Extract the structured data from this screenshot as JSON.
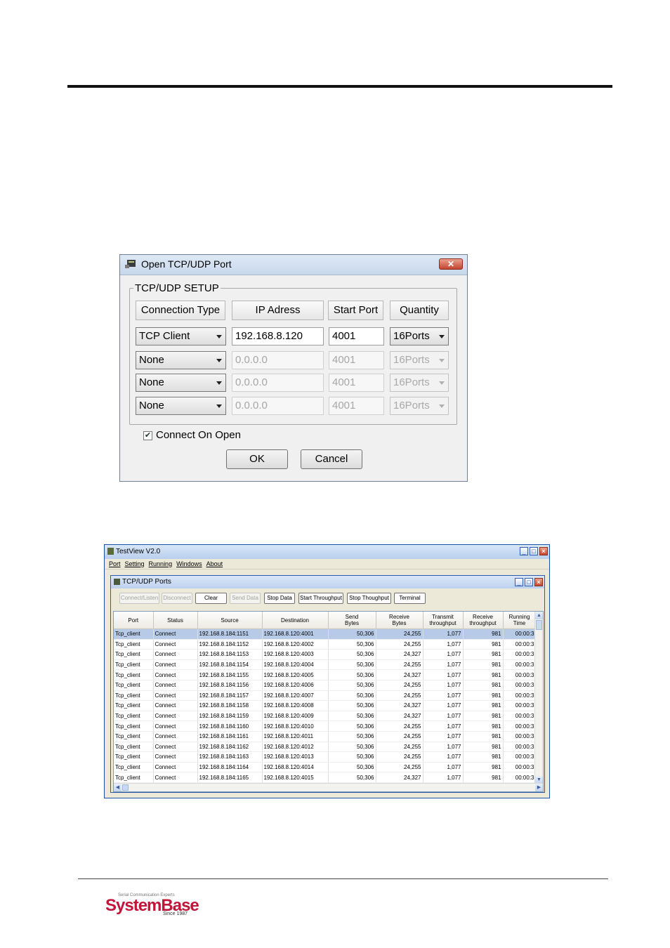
{
  "dialog": {
    "title": "Open TCP/UDP Port",
    "close_label": "✕",
    "group_label": "TCP/UDP SETUP",
    "headers": {
      "connection_type": "Connection Type",
      "ip": "IP Adress",
      "start_port": "Start Port",
      "quantity": "Quantity"
    },
    "rows": [
      {
        "type": "TCP Client",
        "ip": "192.168.8.120",
        "port": "4001",
        "qty": "16Ports",
        "enabled": true
      },
      {
        "type": "None",
        "ip": "0.0.0.0",
        "port": "4001",
        "qty": "16Ports",
        "enabled": false
      },
      {
        "type": "None",
        "ip": "0.0.0.0",
        "port": "4001",
        "qty": "16Ports",
        "enabled": false
      },
      {
        "type": "None",
        "ip": "0.0.0.0",
        "port": "4001",
        "qty": "16Ports",
        "enabled": false
      }
    ],
    "connect_on_open": {
      "label": "Connect On Open",
      "checked": true
    },
    "ok_label": "OK",
    "cancel_label": "Cancel"
  },
  "testview": {
    "title": "TestView V2.0",
    "menu": [
      "Port",
      "Setting",
      "Running",
      "Windows",
      "About"
    ],
    "child_title": "TCP/UDP Ports",
    "toolbar": [
      {
        "label": "Connect/Listen",
        "enabled": false
      },
      {
        "label": "Disconnect",
        "enabled": false
      },
      {
        "label": "Clear",
        "enabled": true
      },
      {
        "label": "Send Data",
        "enabled": false
      },
      {
        "label": "Stop Data",
        "enabled": true
      },
      {
        "label": "Start Throughput",
        "enabled": true
      },
      {
        "label": "Stop Thoughput",
        "enabled": true
      },
      {
        "label": "Terminal",
        "enabled": true
      }
    ],
    "columns": [
      "Port",
      "Status",
      "Source",
      "Destination",
      "Send\nBytes",
      "Receive\nBytes",
      "Transmit\nthroughput",
      "Receive\nthroughput",
      "Running\nTime"
    ],
    "rows": [
      [
        "Tcp_client",
        "Connect",
        "192.168.8.184:1151",
        "192.168.8.120:4001",
        "50,306",
        "24,255",
        "1,077",
        "981",
        "00:00:3"
      ],
      [
        "Tcp_client",
        "Connect",
        "192.168.8.184:1152",
        "192.168.8.120:4002",
        "50,306",
        "24,255",
        "1,077",
        "981",
        "00:00:3"
      ],
      [
        "Tcp_client",
        "Connect",
        "192.168.8.184:1153",
        "192.168.8.120:4003",
        "50,306",
        "24,327",
        "1,077",
        "981",
        "00:00:3"
      ],
      [
        "Tcp_client",
        "Connect",
        "192.168.8.184:1154",
        "192.168.8.120:4004",
        "50,306",
        "24,255",
        "1,077",
        "981",
        "00:00:3"
      ],
      [
        "Tcp_client",
        "Connect",
        "192.168.8.184:1155",
        "192.168.8.120:4005",
        "50,306",
        "24,327",
        "1,077",
        "981",
        "00:00:3"
      ],
      [
        "Tcp_client",
        "Connect",
        "192.168.8.184:1156",
        "192.168.8.120:4006",
        "50,306",
        "24,255",
        "1,077",
        "981",
        "00:00:3"
      ],
      [
        "Tcp_client",
        "Connect",
        "192.168.8.184:1157",
        "192.168.8.120:4007",
        "50,306",
        "24,255",
        "1,077",
        "981",
        "00:00:3"
      ],
      [
        "Tcp_client",
        "Connect",
        "192.168.8.184:1158",
        "192.168.8.120:4008",
        "50,306",
        "24,327",
        "1,077",
        "981",
        "00:00:3"
      ],
      [
        "Tcp_client",
        "Connect",
        "192.168.8.184:1159",
        "192.168.8.120:4009",
        "50,306",
        "24,327",
        "1,077",
        "981",
        "00:00:3"
      ],
      [
        "Tcp_client",
        "Connect",
        "192.168.8.184:1160",
        "192.168.8.120:4010",
        "50,306",
        "24,255",
        "1,077",
        "981",
        "00:00:3"
      ],
      [
        "Tcp_client",
        "Connect",
        "192.168.8.184:1161",
        "192.168.8.120:4011",
        "50,306",
        "24,255",
        "1,077",
        "981",
        "00:00:3"
      ],
      [
        "Tcp_client",
        "Connect",
        "192.168.8.184:1162",
        "192.168.8.120:4012",
        "50,306",
        "24,255",
        "1,077",
        "981",
        "00:00:3"
      ],
      [
        "Tcp_client",
        "Connect",
        "192.168.8.184:1163",
        "192.168.8.120:4013",
        "50,306",
        "24,255",
        "1,077",
        "981",
        "00:00:3"
      ],
      [
        "Tcp_client",
        "Connect",
        "192.168.8.184:1164",
        "192.168.8.120:4014",
        "50,306",
        "24,255",
        "1,077",
        "981",
        "00:00:3"
      ],
      [
        "Tcp_client",
        "Connect",
        "192.168.8.184:1165",
        "192.168.8.120:4015",
        "50,306",
        "24,327",
        "1,077",
        "981",
        "00:00:3"
      ]
    ],
    "selected_row": 0
  },
  "logo": {
    "tagline": "Serial Communication Experts",
    "name": "SystemBase",
    "since": "Since 1987",
    "color": "#c2153a"
  }
}
